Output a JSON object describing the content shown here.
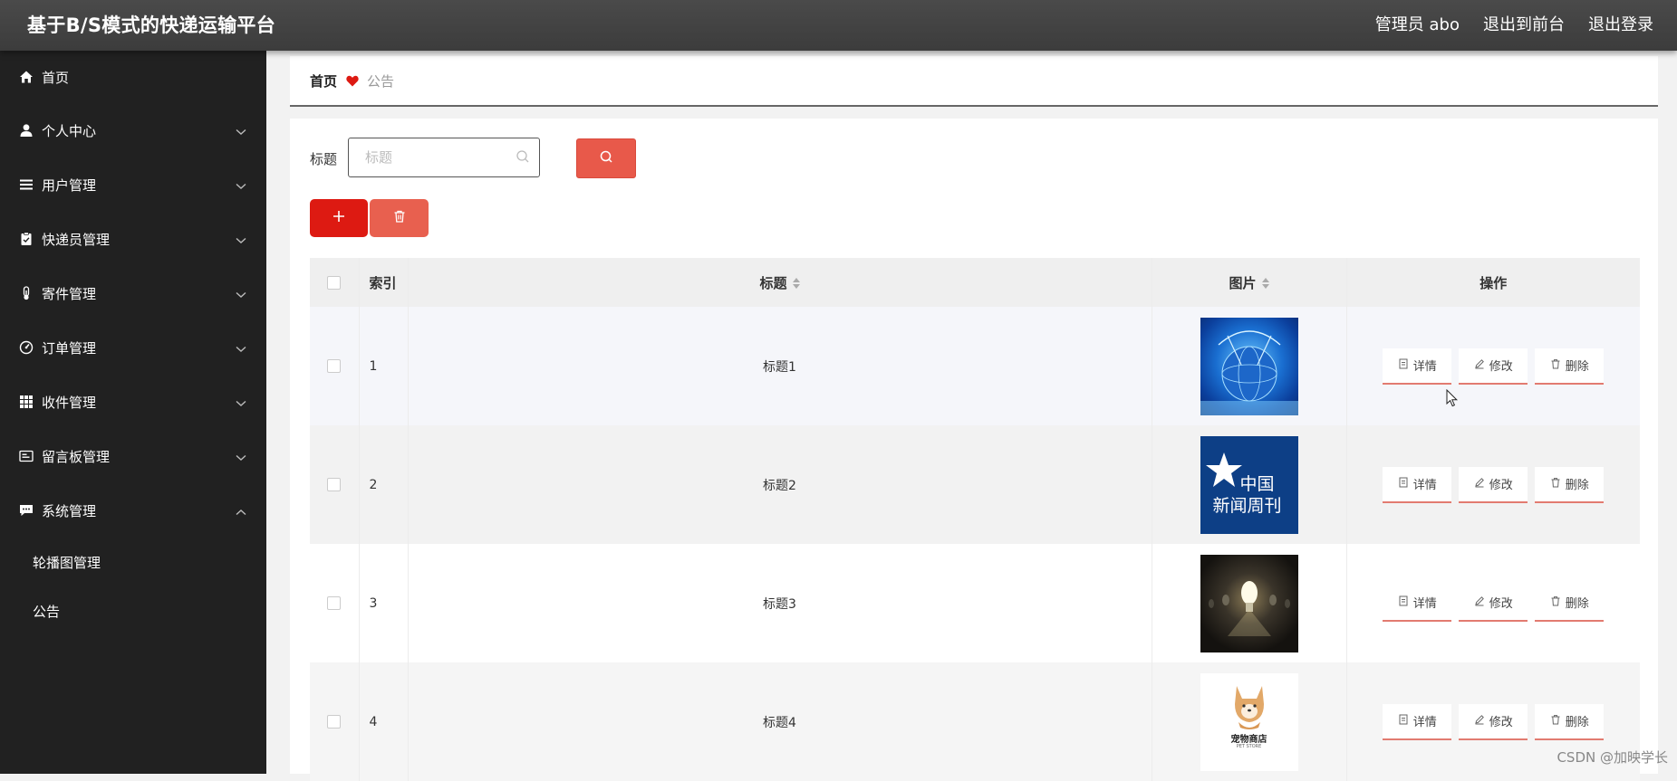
{
  "app": {
    "title": "基于B/S模式的快递运输平台",
    "admin_label": "管理员 abo",
    "exit_front": "退出到前台",
    "logout": "退出登录"
  },
  "sidebar": {
    "items": [
      {
        "label": "首页",
        "icon": "home-icon"
      },
      {
        "label": "个人中心",
        "icon": "user-icon"
      },
      {
        "label": "用户管理",
        "icon": "list-icon"
      },
      {
        "label": "快递员管理",
        "icon": "clipboard-icon"
      },
      {
        "label": "寄件管理",
        "icon": "thermometer-icon"
      },
      {
        "label": "订单管理",
        "icon": "gauge-icon"
      },
      {
        "label": "收件管理",
        "icon": "grid-icon"
      },
      {
        "label": "留言板管理",
        "icon": "message-card-icon"
      },
      {
        "label": "系统管理",
        "icon": "chat-icon"
      }
    ],
    "subitems": [
      {
        "label": "轮播图管理"
      },
      {
        "label": "公告"
      }
    ]
  },
  "breadcrumb": {
    "home": "首页",
    "current": "公告"
  },
  "search": {
    "label": "标题",
    "placeholder": "标题"
  },
  "table": {
    "headers": {
      "index": "索引",
      "title": "标题",
      "image": "图片",
      "actions": "操作"
    },
    "rows": [
      {
        "index": "1",
        "title": "标题1",
        "image": "globe-image"
      },
      {
        "index": "2",
        "title": "标题2",
        "image": "news-weekly-logo-image",
        "image_text_1": "中国",
        "image_text_2": "新闻周刊"
      },
      {
        "index": "3",
        "title": "标题3",
        "image": "light-bulbs-image"
      },
      {
        "index": "4",
        "title": "标题4",
        "image": "pet-store-logo-image",
        "image_text_1": "宠物商店",
        "image_text_2": "PET STORE"
      }
    ],
    "actions": {
      "detail": "详情",
      "edit": "修改",
      "delete": "删除"
    }
  },
  "watermark": "CSDN @加映学长",
  "colors": {
    "header_bg": "#3f3f3f",
    "sidebar_bg": "#212121",
    "primary_red": "#dd1a12",
    "soft_red": "#e8594a"
  }
}
